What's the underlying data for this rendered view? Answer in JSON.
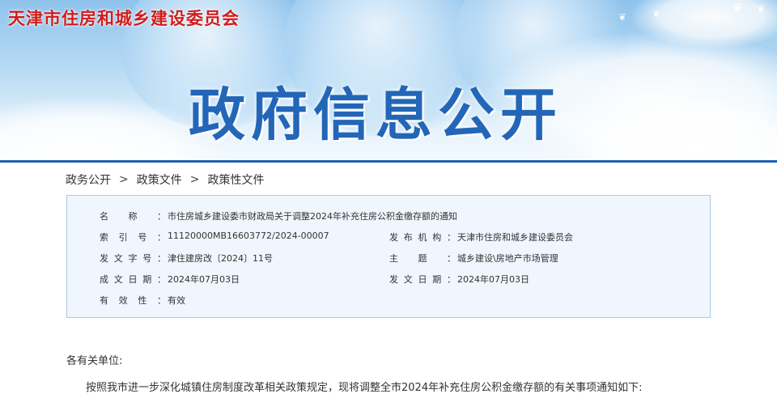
{
  "banner": {
    "org_name": "天津市住房和城乡建设委员会",
    "title": "政府信息公开"
  },
  "breadcrumb": {
    "items": [
      "政务公开",
      "政策文件",
      "政策性文件"
    ],
    "separator": ">"
  },
  "info": {
    "name": {
      "label": "名称",
      "value": "市住房城乡建设委市财政局关于调整2024年补充住房公积金缴存额的通知"
    },
    "index_no": {
      "label": "索引号",
      "value": "11120000MB16603772/2024-00007"
    },
    "issuer": {
      "label": "发布机构",
      "value": "天津市住房和城乡建设委员会"
    },
    "doc_no": {
      "label": "发文字号",
      "value": "津住建房改〔2024〕11号"
    },
    "subject": {
      "label": "主题",
      "value": "城乡建设\\房地产市场管理"
    },
    "date_written": {
      "label": "成文日期",
      "value": "2024年07月03日"
    },
    "date_issued": {
      "label": "发文日期",
      "value": "2024年07月03日"
    },
    "validity": {
      "label": "有效性",
      "value": "有效"
    }
  },
  "body": {
    "salutation": "各有关单位:",
    "paragraph1": "按照我市进一步深化城镇住房制度改革相关政策规定，现将调整全市2024年补充住房公积金缴存额的有关事项通知如下:"
  },
  "colors": {
    "org_red": "#d11c1c",
    "title_blue": "#2366b8",
    "rule_blue": "#1d5fae",
    "box_bg": "#eff6fd",
    "box_border": "#a9cbea"
  }
}
